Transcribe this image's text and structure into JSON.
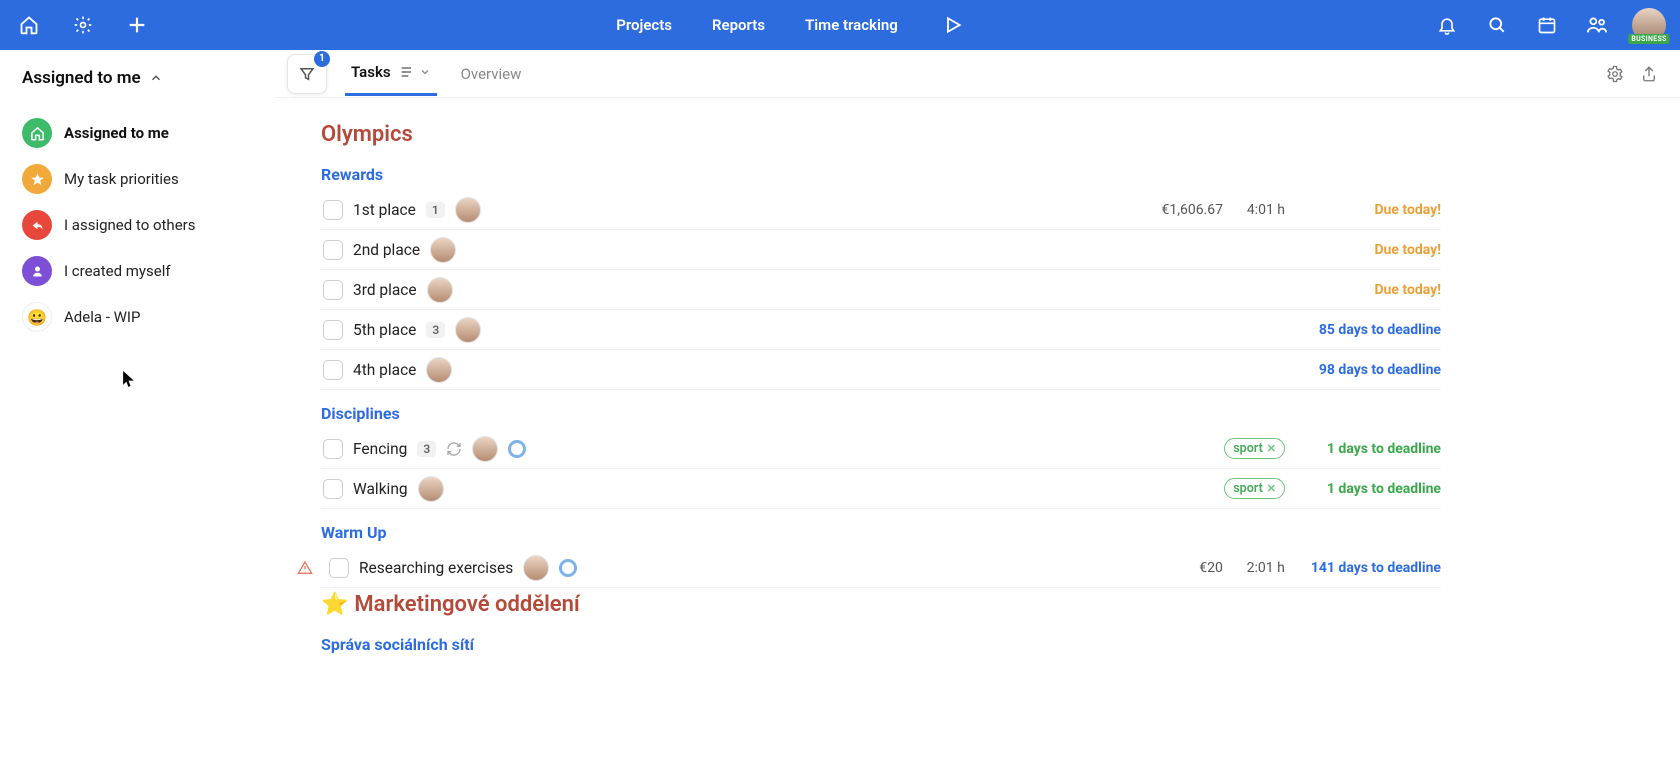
{
  "topnav": {
    "projects": "Projects",
    "reports": "Reports",
    "time": "Time tracking"
  },
  "avatar_plan": "BUSINESS",
  "sidebar": {
    "title": "Assigned to me",
    "items": [
      {
        "label": "Assigned to me"
      },
      {
        "label": "My task priorities"
      },
      {
        "label": "I assigned to others"
      },
      {
        "label": "I created myself"
      },
      {
        "label": "Adela - WIP",
        "emoji": "😀"
      }
    ]
  },
  "tabs": {
    "tasks": "Tasks",
    "overview": "Overview",
    "filter_count": "1"
  },
  "projects": [
    {
      "title": "Olympics",
      "emoji": "",
      "sections": [
        {
          "name": "Rewards",
          "tasks": [
            {
              "name": "1st place",
              "count": "1",
              "money": "€1,606.67",
              "hours": "4:01 h",
              "due": "Due today!",
              "due_cls": "due-today"
            },
            {
              "name": "2nd place",
              "due": "Due today!",
              "due_cls": "due-today"
            },
            {
              "name": "3rd place",
              "due": "Due today!",
              "due_cls": "due-today"
            },
            {
              "name": "5th place",
              "count": "3",
              "due": "85 days to deadline",
              "due_cls": "due-blue"
            },
            {
              "name": "4th place",
              "due": "98 days to deadline",
              "due_cls": "due-blue"
            }
          ]
        },
        {
          "name": "Disciplines",
          "tasks": [
            {
              "name": "Fencing",
              "count": "3",
              "recur": true,
              "ring": true,
              "tag": "sport",
              "due": "1 days to deadline",
              "due_cls": "due-green"
            },
            {
              "name": "Walking",
              "tag": "sport",
              "due": "1 days to deadline",
              "due_cls": "due-green"
            }
          ]
        },
        {
          "name": "Warm Up",
          "tasks": [
            {
              "name": "Researching exercises",
              "warn": true,
              "ring": true,
              "money": "€20",
              "hours": "2:01 h",
              "due": "141 days to deadline",
              "due_cls": "due-blue"
            }
          ]
        }
      ]
    },
    {
      "title": "Marketingové oddělení",
      "emoji": "⭐",
      "sections": [
        {
          "name": "Správa sociálních sítí",
          "tasks": []
        }
      ]
    }
  ]
}
